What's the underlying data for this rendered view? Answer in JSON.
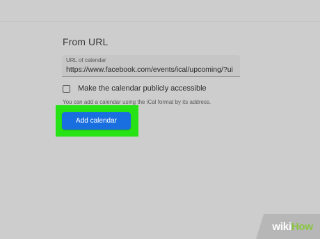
{
  "section": {
    "title": "From URL"
  },
  "url_field": {
    "label": "URL of calendar",
    "value": "https://www.facebook.com/events/ical/upcoming/?ui"
  },
  "public_checkbox": {
    "label": "Make the calendar publicly accessible",
    "checked": false
  },
  "helper_text": "You can add a calendar using the iCal format by its address.",
  "add_button": {
    "label": "Add calendar",
    "color": "#1a6fe0"
  },
  "highlight": {
    "color": "#27e214"
  },
  "watermark": {
    "wiki": "wiki",
    "how": "How"
  }
}
